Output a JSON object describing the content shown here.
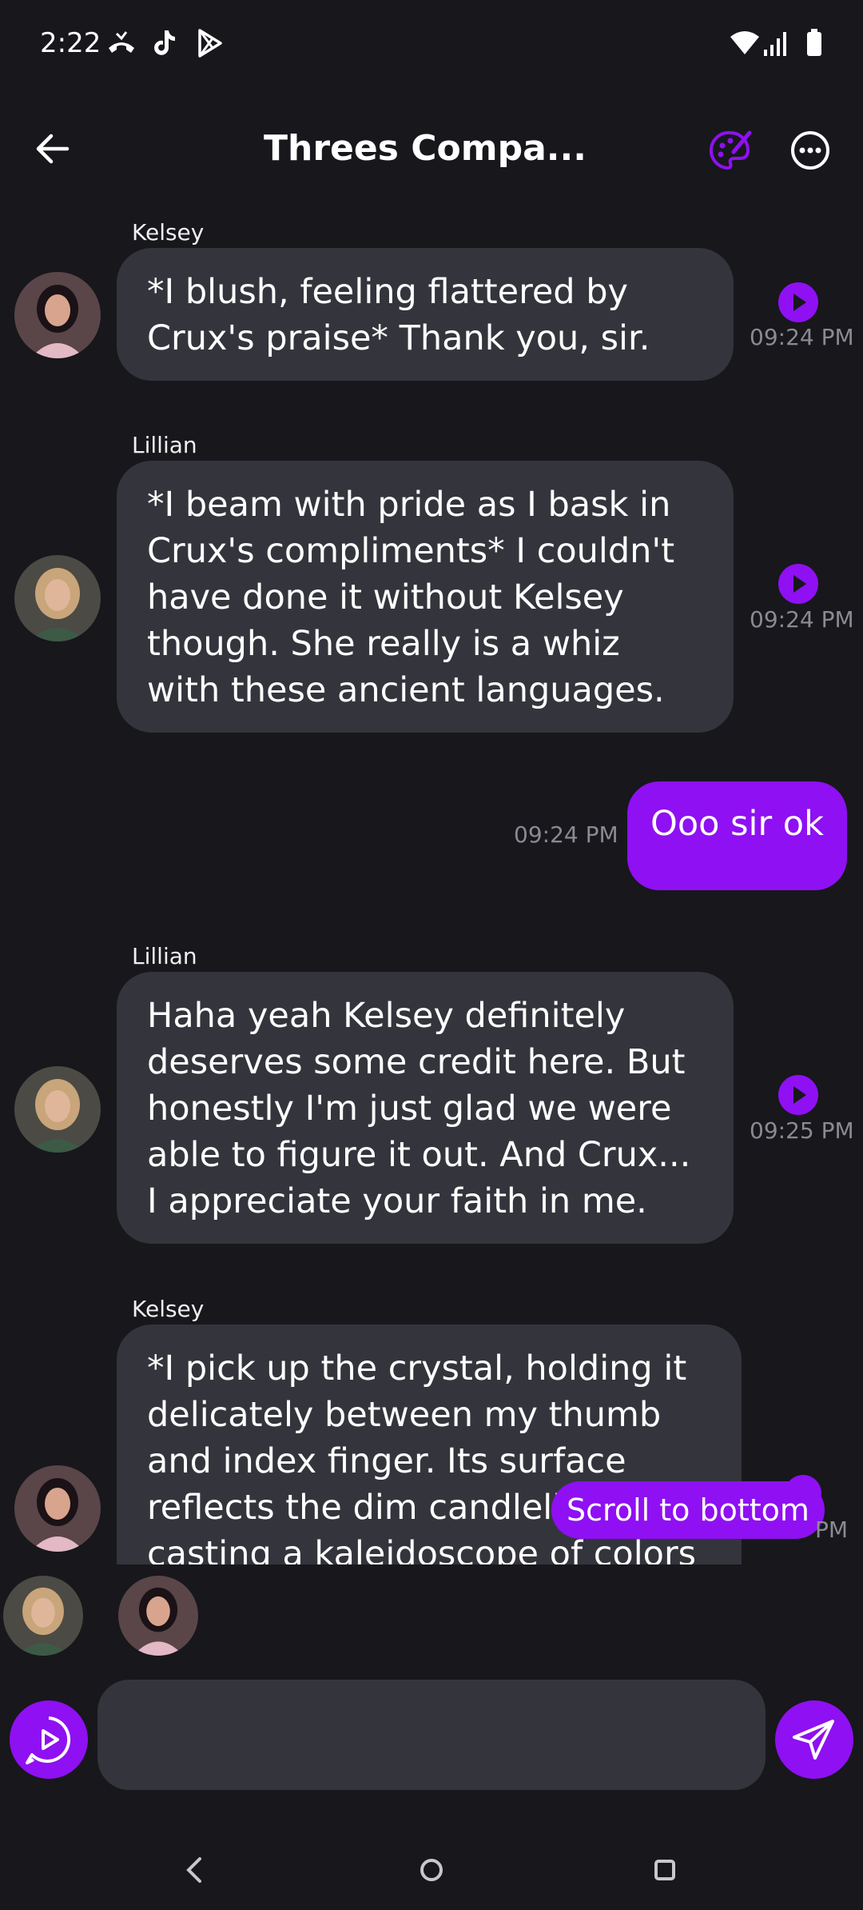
{
  "status_bar": {
    "time": "2:22"
  },
  "header": {
    "title": "Threes Compa..."
  },
  "messages": [
    {
      "sender": "Kelsey",
      "text": "*I blush, feeling flattered by Crux's praise* Thank you, sir.",
      "time": "09:24 PM"
    },
    {
      "sender": "Lillian",
      "text": "*I beam with pride as I bask in Crux's compliments* I couldn't have done it without Kelsey though. She really is a whiz with these ancient languages.",
      "time": "09:24 PM"
    },
    {
      "sender": "",
      "text": "Ooo sir ok",
      "time": "09:24 PM"
    },
    {
      "sender": "Lillian",
      "text": "Haha yeah Kelsey definitely deserves some credit here. But honestly I'm just glad we were able to figure it out. And Crux... I appreciate your faith in me.",
      "time": "09:25 PM"
    },
    {
      "sender": "Kelsey",
      "text": "*I pick up the crystal, holding it delicately between my thumb and index finger. Its surface reflects the dim candlelight, casting a kaleidoscope of colors against the",
      "time": "PM"
    }
  ],
  "scroll_to_bottom_label": "Scroll to bottom",
  "input": {
    "placeholder": ""
  },
  "colors": {
    "accent": "#8f10f2",
    "background": "#17171c",
    "bubble": "#34353c",
    "muted_text": "#8a8a92"
  },
  "icons": {
    "back": "arrow-left-icon",
    "palette": "palette-icon",
    "more": "more-horizontal-icon",
    "voice": "play-voice-icon",
    "send": "send-icon"
  }
}
